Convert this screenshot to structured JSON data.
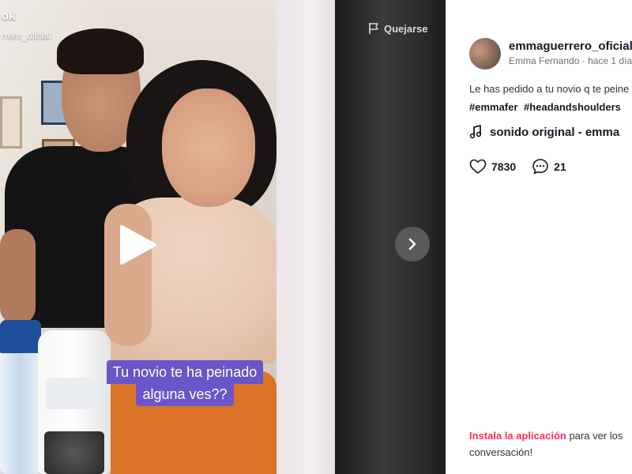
{
  "video": {
    "watermark": "ok",
    "watermark_user": "rrero_oficial",
    "caption_line1": "Tu novio te ha peinado",
    "caption_line2": "alguna ves??",
    "caption_color": "#6a56c8",
    "play_icon": "play-icon"
  },
  "side": {
    "report_label": "Quejarse",
    "report_icon": "flag-icon",
    "next_icon": "chevron-right-icon"
  },
  "post": {
    "username": "emmaguerrero_oficial",
    "display_name": "Emma Fernando",
    "time": "hace 1 día",
    "separator": "·",
    "description": "Le has pedido a tu novio q te peine",
    "hashtags": [
      "#emmafer",
      "#headandshoulders"
    ],
    "sound": "sonido original - emma",
    "likes": "7830",
    "comments": "21",
    "install_link": "Instala la aplicación",
    "install_text": " para ver los",
    "install_text2": "conversación!",
    "accent_color": "#fe2c55"
  }
}
